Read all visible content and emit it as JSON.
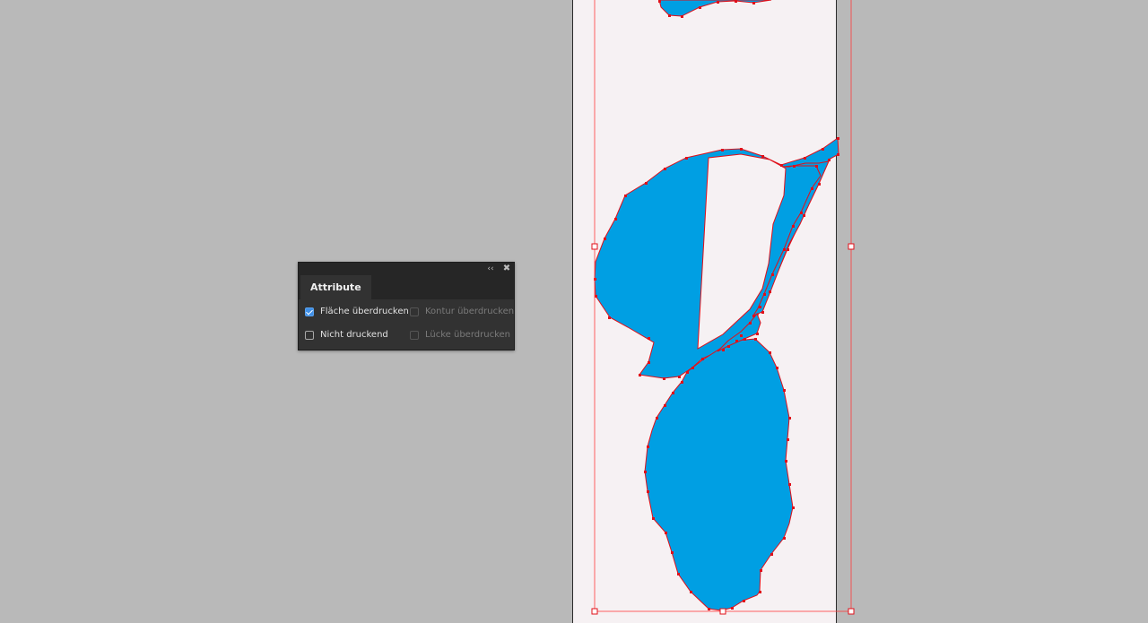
{
  "panel": {
    "collapse_icon": "double-chevron-left-icon",
    "close_icon": "close-icon",
    "tab_label": "Attribute",
    "options": [
      {
        "label": "Fläche überdrucken",
        "checked": true,
        "enabled": true
      },
      {
        "label": "Kontur überdrucken",
        "checked": false,
        "enabled": false
      },
      {
        "label": "Nicht druckend",
        "checked": false,
        "enabled": true
      },
      {
        "label": "Lücke überdrucken",
        "checked": false,
        "enabled": false
      }
    ]
  },
  "colors": {
    "canvas": "#b9b9b9",
    "artboard": "#f6f1f3",
    "shape_fill": "#009fe3",
    "selection": "#ff0000",
    "panel_bg": "#323232",
    "checkbox_accent": "#3f8fe6"
  }
}
